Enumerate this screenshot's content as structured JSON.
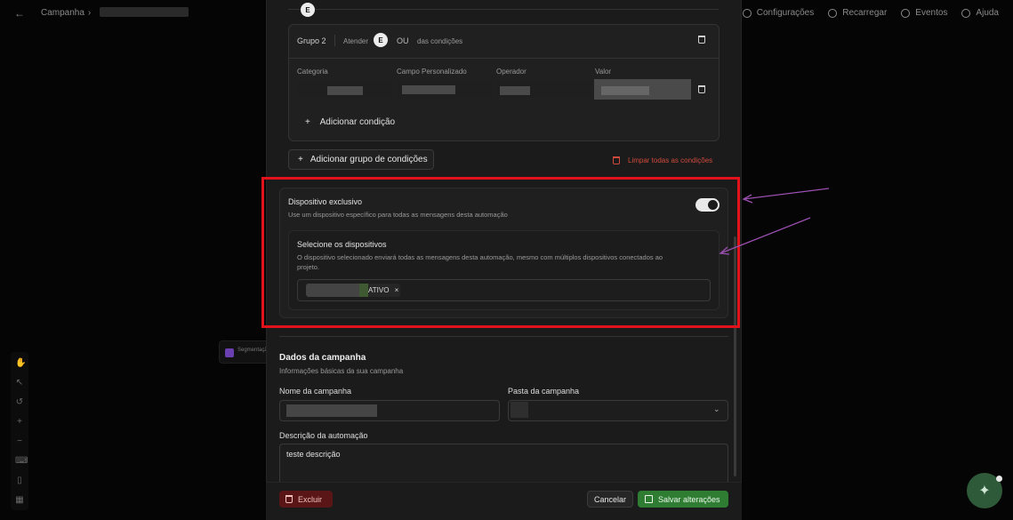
{
  "topbar": {
    "breadcrumb": "Campanha",
    "actions": [
      "Configurações",
      "Recarregar",
      "Eventos",
      "Ajuda"
    ]
  },
  "canvas_node": {
    "label": "Segmentação"
  },
  "group": {
    "title": "Grupo 2",
    "match_label": "Atender",
    "badge": "E",
    "or_label": "OU",
    "conditions_label": "das condições",
    "columns": [
      "Categoria",
      "Campo Personalizado",
      "Operador",
      "Valor"
    ],
    "add_condition": "Adicionar condição"
  },
  "top_badge": "E",
  "add_group": "Adicionar grupo de condições",
  "clear_conditions": "Limpar todas as condições",
  "device": {
    "title": "Dispositivo exclusivo",
    "desc": "Use um dispositivo específico para todas as mensagens desta automação",
    "toggle_on": true,
    "select_title": "Selecione os dispositivos",
    "select_desc_1": "O dispositivo selecionado enviará todas as mensagens desta automação, mesmo com múltiplos dispositivos conectados ao",
    "select_desc_2": "projeto.",
    "chip_status": "ATIVO",
    "chip_close": "×"
  },
  "campaign": {
    "title": "Dados da campanha",
    "subtitle": "Informações básicas da sua campanha",
    "name_label": "Nome da campanha",
    "folder_label": "Pasta da campanha",
    "desc_label": "Descrição da automação",
    "desc_value": "teste descrição"
  },
  "footer": {
    "delete": "Excluir",
    "cancel": "Cancelar",
    "save": "Salvar alterações"
  },
  "colors": {
    "highlight": "#e1121a",
    "annotation_arrow": "#9b4fb0",
    "save": "#2e7d32",
    "delete": "#5a1616"
  }
}
